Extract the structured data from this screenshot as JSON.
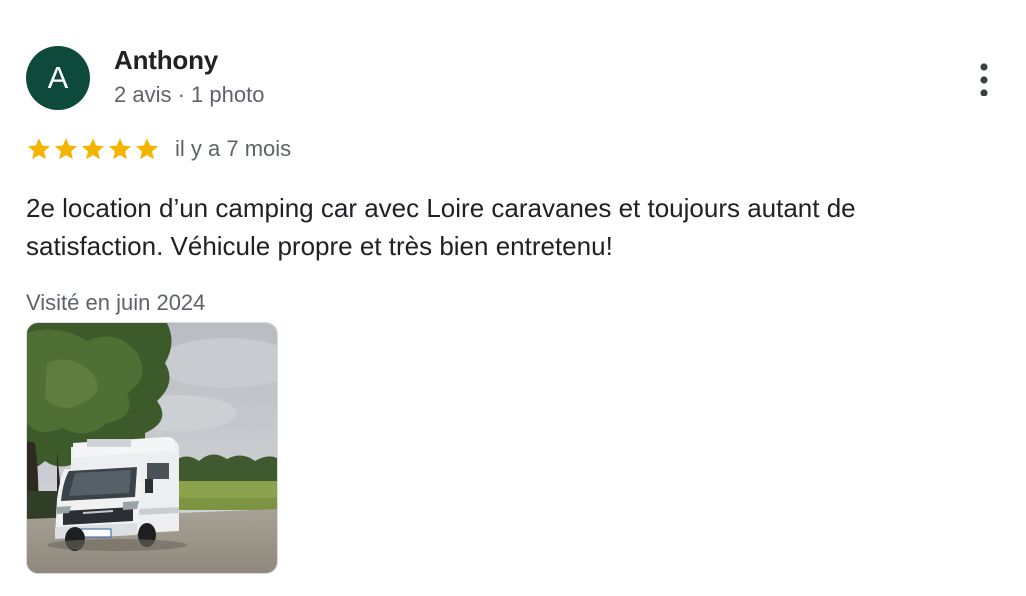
{
  "review": {
    "author": {
      "initial": "A",
      "name": "Anthony",
      "meta": "2 avis · 1 photo",
      "avatar_color": "#0d4a3c"
    },
    "rating": 5,
    "rating_color": "#f4b400",
    "date": "il y a 7 mois",
    "text": "2e location d’un camping car avec Loire caravanes et toujours autant de satisfaction. Véhicule propre et très bien entretenu!",
    "visit": "Visité en juin 2024",
    "photos": [
      {
        "subject": "camping-car",
        "plate": "GL-122-MQ"
      }
    ],
    "icons": {
      "more": "more-vert-icon",
      "star": "star-icon"
    }
  }
}
